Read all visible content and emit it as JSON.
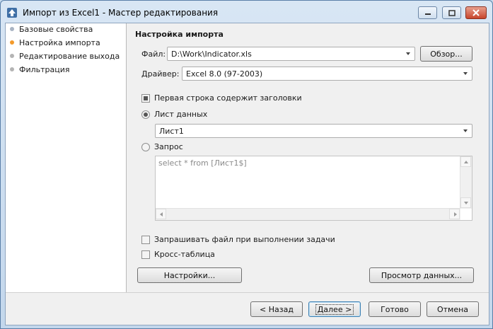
{
  "window": {
    "title": "Импорт из Excel1 - Мастер редактирования",
    "icon": "app-upload-icon"
  },
  "sidebar": {
    "items": [
      {
        "label": "Базовые свойства",
        "dot_color": "#a9b4c3"
      },
      {
        "label": "Настройка импорта",
        "dot_color": "#f39a2b"
      },
      {
        "label": "Редактирование выхода",
        "dot_color": "#b4b4b4"
      },
      {
        "label": "Фильтрация",
        "dot_color": "#b4b4b4"
      }
    ]
  },
  "section": {
    "title": "Настройка импорта"
  },
  "file": {
    "label": "Файл:",
    "value": "D:\\Work\\Indicator.xls",
    "browse_label": "Обзор..."
  },
  "driver": {
    "label": "Драйвер:",
    "value": "Excel 8.0 (97-2003)"
  },
  "first_row_headers": {
    "label": "Первая строка содержит заголовки",
    "checked": true
  },
  "sheet": {
    "label": "Лист данных",
    "selected": true,
    "value": "Лист1"
  },
  "query": {
    "label": "Запрос",
    "selected": false,
    "text": "select * from [Лист1$]"
  },
  "ask_file": {
    "label": "Запрашивать файл при выполнении задачи",
    "checked": false
  },
  "cross_table": {
    "label": "Кросс-таблица",
    "checked": false
  },
  "buttons": {
    "settings": "Настройки...",
    "preview": "Просмотр данных...",
    "back": "< Назад",
    "next": "Далее >",
    "finish": "Готово",
    "cancel": "Отмена"
  }
}
